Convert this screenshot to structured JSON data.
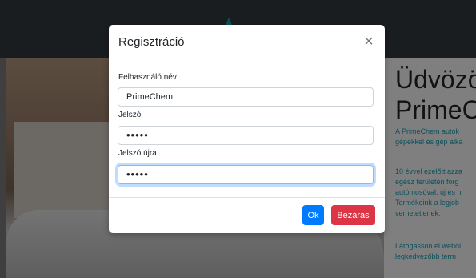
{
  "background": {
    "hero_title": "Üdvözölj\nPrimeCh",
    "p1": "A PrimeChem autók\ngépekkel és gép alka",
    "p2": "10 évvel ezelőtt azza\negész területén forg\nautómosóval, új és h\nTermékeink a legjob\nverhetetlenek.",
    "p3": "Látogasson el webol\nlegkedvezőbb term"
  },
  "modal": {
    "title": "Regisztráció",
    "close_icon": "×",
    "username_label": "Felhasználó név",
    "username_value": "PrimeChem",
    "password_label": "Jelszó",
    "password_value": "•••••",
    "password_again_label": "Jelszó újra",
    "password_again_value": "•••••",
    "ok_label": "Ok",
    "close_label": "Bezárás"
  },
  "colors": {
    "primary": "#007bff",
    "danger": "#dc3545",
    "link": "#17a2b8"
  }
}
